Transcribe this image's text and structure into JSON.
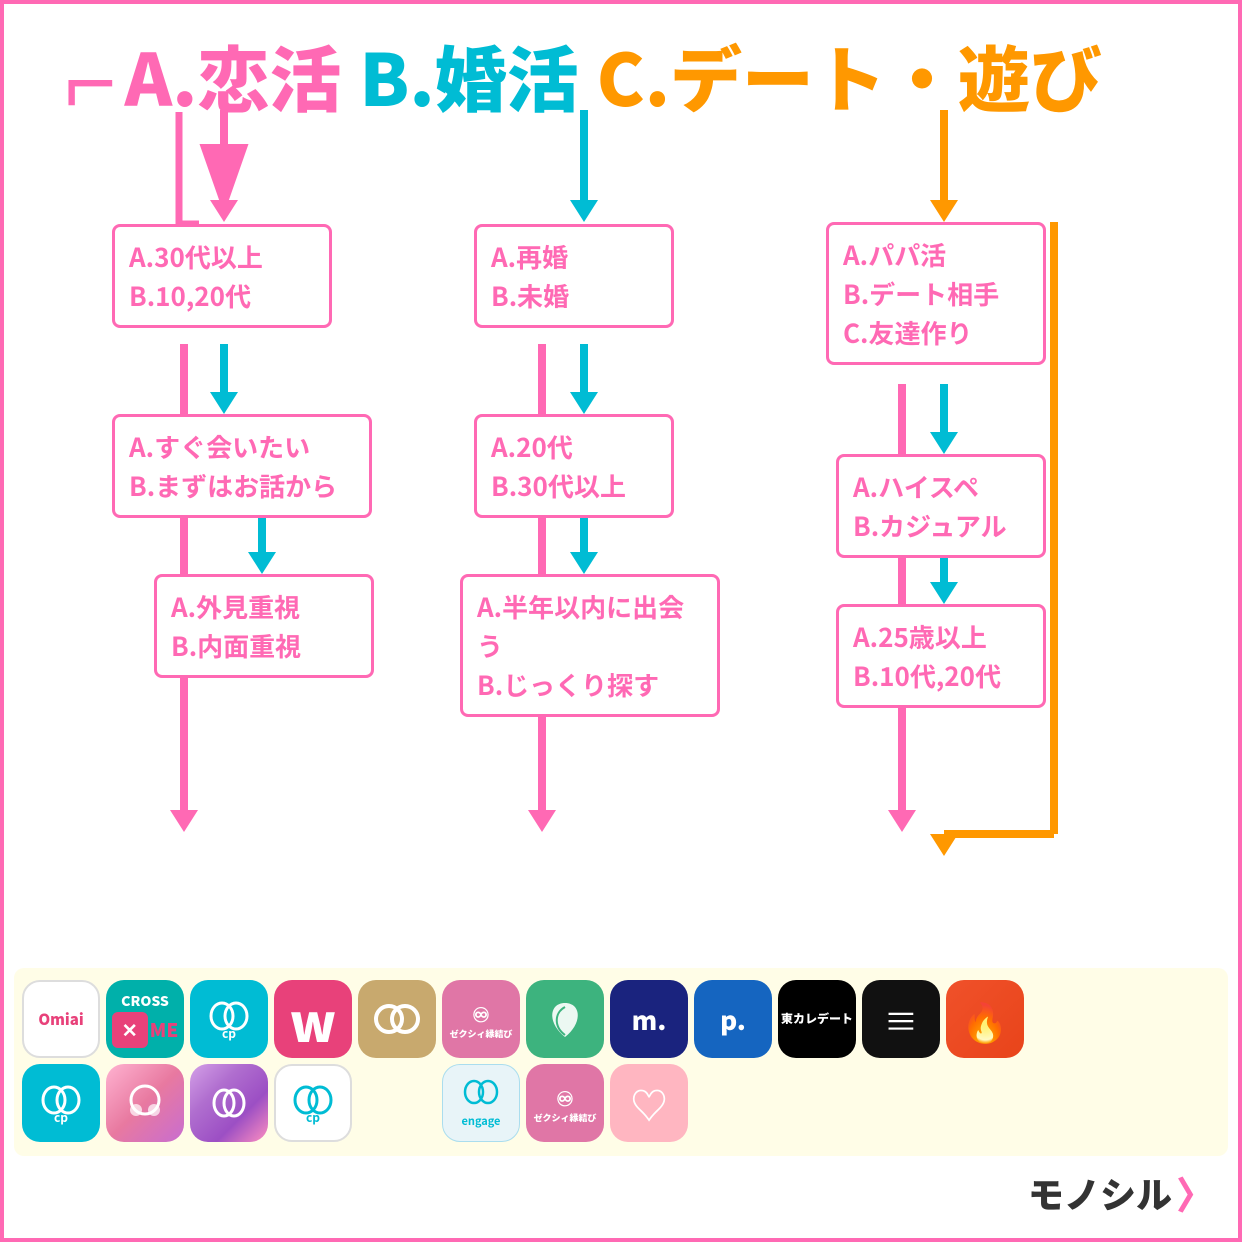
{
  "title": {
    "bracket": "「",
    "partA": "A.恋活",
    "partB": "B.婚活",
    "partC": "C.デート・遊び"
  },
  "boxes": {
    "col1_row1": {
      "lines": [
        "A.30代以上",
        "B.10,20代"
      ]
    },
    "col1_row2": {
      "lines": [
        "A.すぐ会いたい",
        "B.まずはお話から"
      ]
    },
    "col1_row3": {
      "lines": [
        "A.外見重視",
        "B.内面重視"
      ]
    },
    "col2_row1": {
      "lines": [
        "A.再婚",
        "B.未婚"
      ]
    },
    "col2_row2": {
      "lines": [
        "A.20代",
        "B.30代以上"
      ]
    },
    "col2_row3": {
      "lines": [
        "A.半年以内に出会う",
        "B.じっくり探す"
      ]
    },
    "col3_row1": {
      "lines": [
        "A.パパ活",
        "B.デート相手",
        "C.友達作り"
      ]
    },
    "col3_row2": {
      "lines": [
        "A.ハイスペ",
        "B.カジュアル"
      ]
    },
    "col3_row3": {
      "lines": [
        "A.25歳以上",
        "B.10代,20代"
      ]
    }
  },
  "apps": {
    "row1": [
      {
        "id": "omiai",
        "label": "Omiai",
        "bg": "#ffffff",
        "color": "#888"
      },
      {
        "id": "crossme",
        "label": "CROSS\nME",
        "bg": "#00b0aa",
        "color": "#ffffff"
      },
      {
        "id": "pairs",
        "label": "☁p",
        "bg": "#00bcd4",
        "color": "#ffffff"
      },
      {
        "id": "with",
        "label": "w",
        "bg": "#e8417a",
        "color": "#ffffff"
      },
      {
        "id": "zexy",
        "label": "○",
        "bg": "#c8a96e",
        "color": "#ffffff"
      },
      {
        "id": "brides",
        "label": "縁結び",
        "bg": "#e76bab",
        "color": "#ffffff"
      },
      {
        "id": "mitsukoi",
        "label": "✿",
        "bg": "#3db37e",
        "color": "#ffffff"
      },
      {
        "id": "marriage",
        "label": "m.",
        "bg": "#1a237e",
        "color": "#ffffff"
      },
      {
        "id": "pcmax",
        "label": "p.",
        "bg": "#1565c0",
        "color": "#ffffff"
      },
      {
        "id": "higashidate",
        "label": "東カレ\nデート",
        "bg": "#000000",
        "color": "#ffffff"
      },
      {
        "id": "match",
        "label": "≡",
        "bg": "#111111",
        "color": "#ffffff"
      },
      {
        "id": "tinder",
        "label": "🔥",
        "bg": "#e8441a",
        "color": "#ffffff"
      }
    ],
    "row2": [
      {
        "id": "pairs2",
        "label": "☁p",
        "bg": "#00bcd4",
        "color": "#ffffff"
      },
      {
        "id": "hinge",
        "label": "",
        "bg": "linear-gradient(135deg,#ff9a9e,#fad0c4)",
        "color": "#fff"
      },
      {
        "id": "bumble",
        "label": "",
        "bg": "linear-gradient(135deg,#ffd6e7,#c9a0dc)",
        "color": "#fff"
      },
      {
        "id": "pairs3",
        "label": "☁p",
        "bg": "#ffffff",
        "color": "#00bcd4"
      },
      {
        "id": "engage",
        "label": "engage",
        "bg": "#e8f4f8",
        "color": "#00bcd4"
      },
      {
        "id": "zexy2",
        "label": "縁結び",
        "bg": "#e76bab",
        "color": "#ffffff"
      },
      {
        "id": "yomimono",
        "label": "♡",
        "bg": "#ffb6c1",
        "color": "#fff"
      }
    ]
  },
  "watermark": {
    "text": "モノシル",
    "chevron": "〉"
  }
}
